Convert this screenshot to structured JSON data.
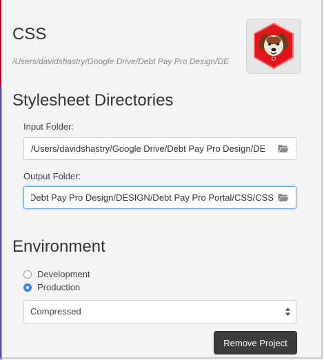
{
  "project": {
    "title": "CSS",
    "path": "/Users/davidshastry/Google Drive/Debt Pay Pro Design/DE",
    "logo_icon": "dog-hexagon-logo"
  },
  "stylesheet_section": {
    "title": "Stylesheet Directories",
    "input_label": "Input Folder:",
    "input_value": "/Users/davidshastry/Google Drive/Debt Pay Pro Design/DE",
    "output_label": "Output Folder:",
    "output_value": "Debt Pay Pro Design/DESIGN/Debt Pay Pro Portal/CSS/CSS",
    "folder_icon": "folder-open-icon"
  },
  "environment_section": {
    "title": "Environment",
    "options": [
      {
        "label": "Development",
        "checked": false
      },
      {
        "label": "Production",
        "checked": true
      }
    ],
    "output_style": "Compressed"
  },
  "actions": {
    "remove_label": "Remove Project"
  },
  "colors": {
    "accent_red": "#b00020",
    "radio_blue": "#3b89f7",
    "button_dark": "#3c3c3c"
  }
}
